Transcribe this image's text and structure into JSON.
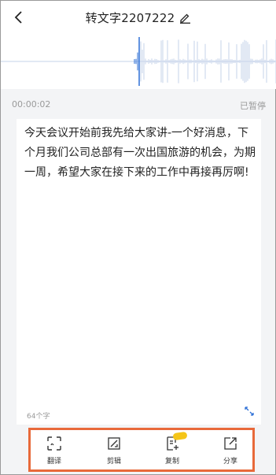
{
  "header": {
    "back_icon": "chevron-left-icon",
    "title": "转文字2207222",
    "edit_icon": "pencil-icon"
  },
  "playback": {
    "current_time": "00:00:02",
    "status": "已暂停"
  },
  "transcript": {
    "text": "今天会议开始前我先给大家讲-一个好消息，下个月我们公司总部有一次出国旅游的机会，为期一周，希望大家在接下来的工作中再接再厉啊!",
    "char_count": "64个字",
    "expand_icon": "expand-arrows-icon"
  },
  "toolbar": {
    "items": [
      {
        "label": "翻译",
        "icon": "translate-icon"
      },
      {
        "label": "剪辑",
        "icon": "crop-icon"
      },
      {
        "label": "复制",
        "icon": "copy-icon"
      },
      {
        "label": "分享",
        "icon": "share-icon"
      }
    ],
    "highlight_color": "#e8693a"
  },
  "colors": {
    "waveform": "#2d6fd6",
    "waveform_muted": "#c5d3ea"
  }
}
